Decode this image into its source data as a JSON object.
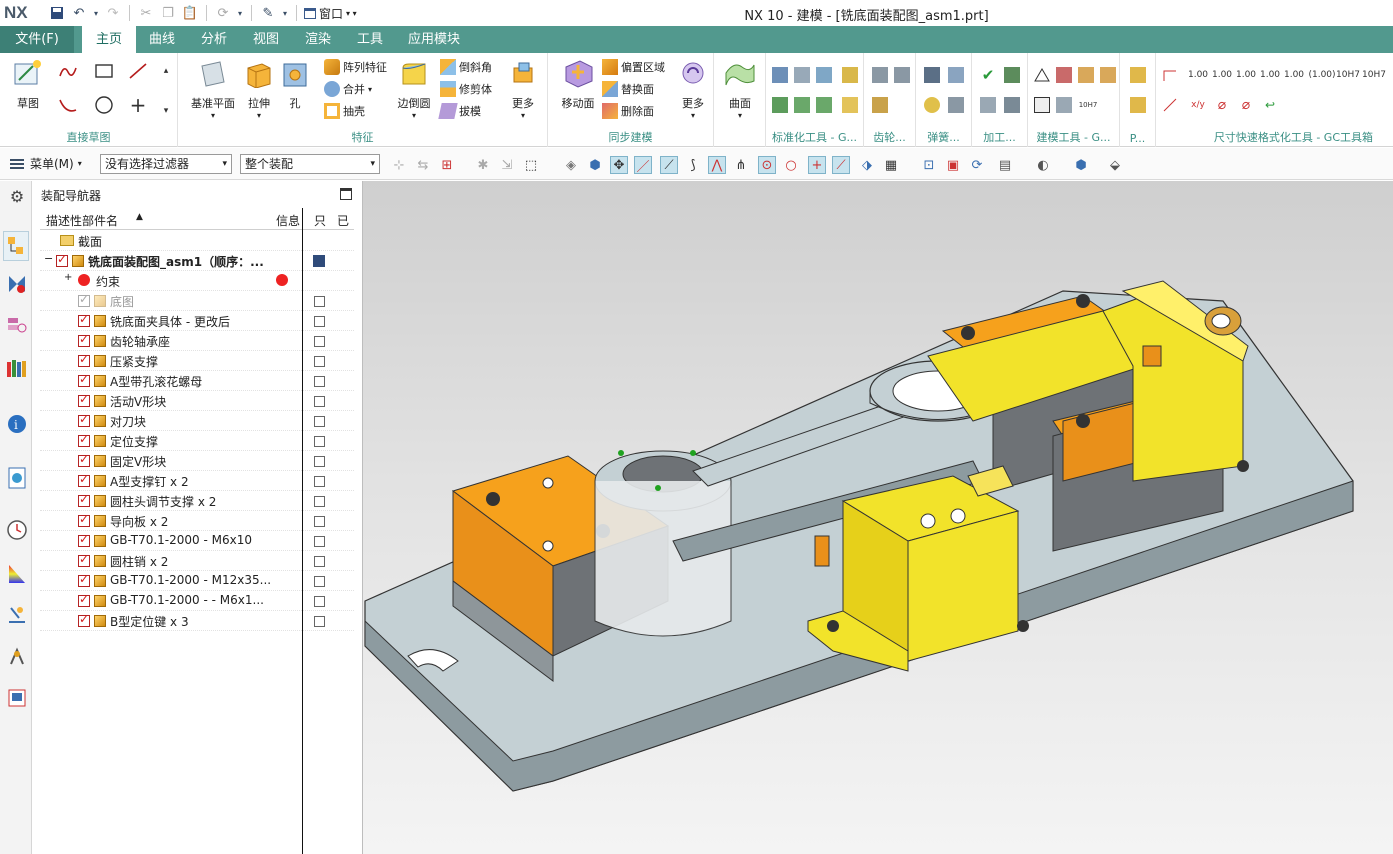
{
  "app": {
    "logo": "NX",
    "title": "NX 10 - 建模 - [铣底面装配图_asm1.prt]",
    "window_menu": "窗口"
  },
  "ribbon_tabs": [
    {
      "label": "文件(F)"
    },
    {
      "label": "主页"
    },
    {
      "label": "曲线"
    },
    {
      "label": "分析"
    },
    {
      "label": "视图"
    },
    {
      "label": "渲染"
    },
    {
      "label": "工具"
    },
    {
      "label": "应用模块"
    }
  ],
  "ribbon": {
    "sketch": "草图",
    "direct_sketch_group": "直接草图",
    "feature_group": "特征",
    "datum_plane": "基准平面",
    "extrude": "拉伸",
    "hole": "孔",
    "pattern_feature": "阵列特征",
    "unite": "合并",
    "shell": "抽壳",
    "edge_blend": "边倒圆",
    "chamfer": "倒斜角",
    "trim_body": "修剪体",
    "draft": "拔模",
    "more1": "更多",
    "sync_group": "同步建模",
    "move_face": "移动面",
    "offset_region": "偏置区域",
    "replace_face": "替换面",
    "delete_face": "删除面",
    "more2": "更多",
    "surface": "曲面",
    "std_tools_group": "标准化工具 - G...",
    "gear_group": "齿轮...",
    "spring_group": "弹簧...",
    "machining_group": "加工...",
    "modeling_tools_group": "建模工具 - G...",
    "p_group": "P...",
    "dim_group": "尺寸快速格式化工具 - GC工具箱",
    "dim_values": [
      "1.00",
      "1.00",
      "1.00",
      "1.00",
      "1.00",
      "(1.00)",
      "10H7",
      "10H7"
    ],
    "tol_value": "10H7"
  },
  "selbar": {
    "menu": "菜单(M)",
    "filter": "没有选择过滤器",
    "scope": "整个装配"
  },
  "navigator": {
    "title": "装配导航器",
    "columns": {
      "name": "描述性部件名",
      "info": "信息",
      "readonly": "只",
      "modified": "已"
    },
    "rows": [
      {
        "name": "截面",
        "type": "folder"
      },
      {
        "name": "铣底面装配图_asm1（顺序：...",
        "type": "asm"
      },
      {
        "name": "约束",
        "type": "constraint"
      },
      {
        "name": "底图",
        "type": "part",
        "gray": true
      },
      {
        "name": "铣底面夹具体 - 更改后",
        "type": "part"
      },
      {
        "name": "齿轮轴承座",
        "type": "part"
      },
      {
        "name": "压紧支撑",
        "type": "part"
      },
      {
        "name": "A型带孔滚花螺母",
        "type": "part"
      },
      {
        "name": "活动V形块",
        "type": "part"
      },
      {
        "name": "对刀块",
        "type": "part"
      },
      {
        "name": "定位支撑",
        "type": "part"
      },
      {
        "name": "固定V形块",
        "type": "part"
      },
      {
        "name": "A型支撑钉 x 2",
        "type": "part"
      },
      {
        "name": "圆柱头调节支撑 x 2",
        "type": "part"
      },
      {
        "name": "导向板 x 2",
        "type": "part"
      },
      {
        "name": "GB-T70.1-2000 - M6x10",
        "type": "part"
      },
      {
        "name": "圆柱销 x 2",
        "type": "part"
      },
      {
        "name": "GB-T70.1-2000 - M12x35...",
        "type": "part"
      },
      {
        "name": "GB-T70.1-2000 -  - M6x1...",
        "type": "part"
      },
      {
        "name": "B型定位键 x 3",
        "type": "part"
      }
    ]
  },
  "colors": {
    "ribbon": "#52998e",
    "file_tab": "#3d8076",
    "part_yellow": "#f2e32a",
    "part_orange": "#f29a18",
    "base_gray": "#bcc8cc"
  }
}
